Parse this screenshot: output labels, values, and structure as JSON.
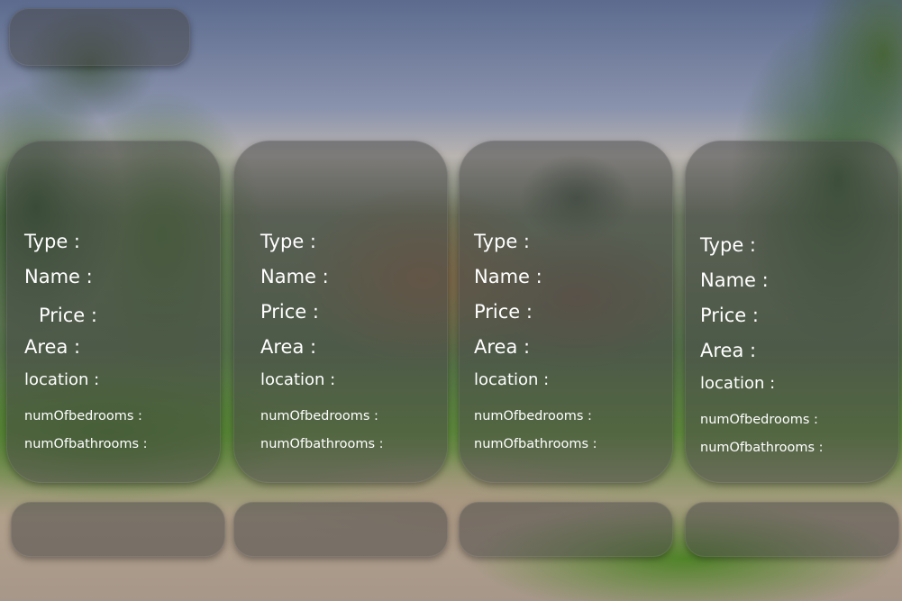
{
  "cards": [
    {
      "type_label": "Type   :",
      "name_label": "Name :",
      "price_label": "Price  :",
      "area_label": "Area   :",
      "location_label": "location :",
      "bedrooms_label": "numOfbedrooms :",
      "bathrooms_label": "numOfbathrooms :"
    },
    {
      "type_label": "Type   :",
      "name_label": "Name :",
      "price_label": "Price  :",
      "area_label": "Area   :",
      "location_label": "location :",
      "bedrooms_label": "numOfbedrooms :",
      "bathrooms_label": "numOfbathrooms :"
    },
    {
      "type_label": "Type   :",
      "name_label": "Name :",
      "price_label": "Price  :",
      "area_label": "Area   :",
      "location_label": "location :",
      "bedrooms_label": "numOfbedrooms :",
      "bathrooms_label": "numOfbathrooms :"
    },
    {
      "type_label": "Type   :",
      "name_label": "Name :",
      "price_label": "Price  :",
      "area_label": "Area   :",
      "location_label": "location :",
      "bedrooms_label": "numOfbedrooms :",
      "bathrooms_label": "numOfbathrooms :"
    }
  ],
  "colors": {
    "panel": "#464646",
    "text": "#ffffff"
  }
}
